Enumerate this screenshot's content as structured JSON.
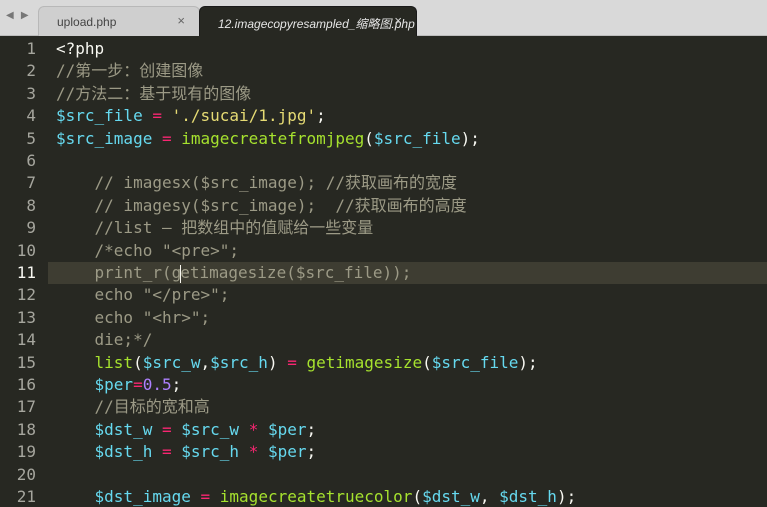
{
  "tabs": [
    {
      "label": "upload.php",
      "close": "×"
    },
    {
      "label": "12.imagecopyresampled_缩略图.php",
      "close": "×"
    }
  ],
  "nav": {
    "back": "◀",
    "forward": "▶"
  },
  "current_line": 11,
  "lines": [
    {
      "n": "1",
      "indent": 0,
      "tokens": [
        {
          "t": "kw",
          "v": "<?php"
        }
      ]
    },
    {
      "n": "2",
      "indent": 0,
      "tokens": [
        {
          "t": "comment",
          "v": "//第一步：创建图像"
        }
      ]
    },
    {
      "n": "3",
      "indent": 0,
      "tokens": [
        {
          "t": "comment",
          "v": "//方法二：基于现有的图像"
        }
      ]
    },
    {
      "n": "4",
      "indent": 0,
      "tokens": [
        {
          "t": "var",
          "v": "$src_file"
        },
        {
          "t": "text",
          "v": " "
        },
        {
          "t": "op",
          "v": "="
        },
        {
          "t": "text",
          "v": " "
        },
        {
          "t": "str",
          "v": "'./sucai/1.jpg'"
        },
        {
          "t": "text",
          "v": ";"
        }
      ]
    },
    {
      "n": "5",
      "indent": 0,
      "tokens": [
        {
          "t": "var",
          "v": "$src_image"
        },
        {
          "t": "text",
          "v": " "
        },
        {
          "t": "op",
          "v": "="
        },
        {
          "t": "text",
          "v": " "
        },
        {
          "t": "fn",
          "v": "imagecreatefromjpeg"
        },
        {
          "t": "text",
          "v": "("
        },
        {
          "t": "var",
          "v": "$src_file"
        },
        {
          "t": "text",
          "v": ");"
        }
      ]
    },
    {
      "n": "6",
      "indent": 0,
      "tokens": []
    },
    {
      "n": "7",
      "indent": 1,
      "tokens": [
        {
          "t": "comment",
          "v": "// imagesx($src_image); //获取画布的宽度"
        }
      ]
    },
    {
      "n": "8",
      "indent": 1,
      "tokens": [
        {
          "t": "comment",
          "v": "// imagesy($src_image);  //获取画布的高度"
        }
      ]
    },
    {
      "n": "9",
      "indent": 1,
      "tokens": [
        {
          "t": "comment",
          "v": "//list — 把数组中的值赋给一些变量"
        }
      ]
    },
    {
      "n": "10",
      "indent": 1,
      "tokens": [
        {
          "t": "comment",
          "v": "/*echo \"<pre>\";"
        }
      ]
    },
    {
      "n": "11",
      "indent": 1,
      "tokens": [
        {
          "t": "comment",
          "v": "print_r(g"
        },
        {
          "t": "caret",
          "v": ""
        },
        {
          "t": "comment",
          "v": "etimagesize($src_file));"
        }
      ]
    },
    {
      "n": "12",
      "indent": 1,
      "tokens": [
        {
          "t": "comment",
          "v": "echo \"</pre>\";"
        }
      ]
    },
    {
      "n": "13",
      "indent": 1,
      "tokens": [
        {
          "t": "comment",
          "v": "echo \"<hr>\";"
        }
      ]
    },
    {
      "n": "14",
      "indent": 1,
      "tokens": [
        {
          "t": "comment",
          "v": "die;*/"
        }
      ]
    },
    {
      "n": "15",
      "indent": 1,
      "tokens": [
        {
          "t": "fn",
          "v": "list"
        },
        {
          "t": "text",
          "v": "("
        },
        {
          "t": "var",
          "v": "$src_w"
        },
        {
          "t": "text",
          "v": ","
        },
        {
          "t": "var",
          "v": "$src_h"
        },
        {
          "t": "text",
          "v": ") "
        },
        {
          "t": "op",
          "v": "="
        },
        {
          "t": "text",
          "v": " "
        },
        {
          "t": "fn",
          "v": "getimagesize"
        },
        {
          "t": "text",
          "v": "("
        },
        {
          "t": "var",
          "v": "$src_file"
        },
        {
          "t": "text",
          "v": ");"
        }
      ]
    },
    {
      "n": "16",
      "indent": 1,
      "tokens": [
        {
          "t": "var",
          "v": "$per"
        },
        {
          "t": "op",
          "v": "="
        },
        {
          "t": "num",
          "v": "0.5"
        },
        {
          "t": "text",
          "v": ";"
        }
      ]
    },
    {
      "n": "17",
      "indent": 1,
      "tokens": [
        {
          "t": "comment",
          "v": "//目标的宽和高"
        }
      ]
    },
    {
      "n": "18",
      "indent": 1,
      "tokens": [
        {
          "t": "var",
          "v": "$dst_w"
        },
        {
          "t": "text",
          "v": " "
        },
        {
          "t": "op",
          "v": "="
        },
        {
          "t": "text",
          "v": " "
        },
        {
          "t": "var",
          "v": "$src_w"
        },
        {
          "t": "text",
          "v": " "
        },
        {
          "t": "op",
          "v": "*"
        },
        {
          "t": "text",
          "v": " "
        },
        {
          "t": "var",
          "v": "$per"
        },
        {
          "t": "text",
          "v": ";"
        }
      ]
    },
    {
      "n": "19",
      "indent": 1,
      "tokens": [
        {
          "t": "var",
          "v": "$dst_h"
        },
        {
          "t": "text",
          "v": " "
        },
        {
          "t": "op",
          "v": "="
        },
        {
          "t": "text",
          "v": " "
        },
        {
          "t": "var",
          "v": "$src_h"
        },
        {
          "t": "text",
          "v": " "
        },
        {
          "t": "op",
          "v": "*"
        },
        {
          "t": "text",
          "v": " "
        },
        {
          "t": "var",
          "v": "$per"
        },
        {
          "t": "text",
          "v": ";"
        }
      ]
    },
    {
      "n": "20",
      "indent": 0,
      "tokens": []
    },
    {
      "n": "21",
      "indent": 1,
      "tokens": [
        {
          "t": "var",
          "v": "$dst_image"
        },
        {
          "t": "text",
          "v": " "
        },
        {
          "t": "op",
          "v": "="
        },
        {
          "t": "text",
          "v": " "
        },
        {
          "t": "fn",
          "v": "imagecreatetruecolor"
        },
        {
          "t": "text",
          "v": "("
        },
        {
          "t": "var",
          "v": "$dst_w"
        },
        {
          "t": "text",
          "v": ", "
        },
        {
          "t": "var",
          "v": "$dst_h"
        },
        {
          "t": "text",
          "v": ");"
        }
      ]
    }
  ]
}
